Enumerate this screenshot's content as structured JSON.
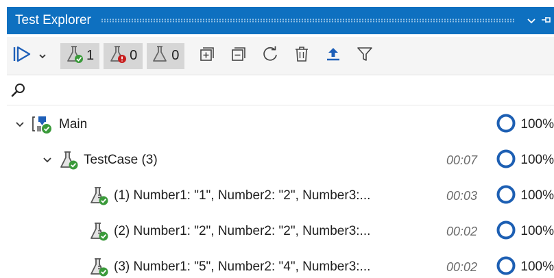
{
  "window": {
    "title": "Test Explorer"
  },
  "toolbar": {
    "passed_count": "1",
    "failed_count": "0",
    "notrun_count": "0"
  },
  "search": {
    "placeholder": ""
  },
  "tree": [
    {
      "label": "Main",
      "duration": "",
      "coverage": "100%"
    },
    {
      "label": "TestCase (3)",
      "duration": "00:07",
      "coverage": "100%"
    },
    {
      "label": "(1) Number1: \"1\", Number2: \"2\", Number3:...",
      "duration": "00:03",
      "coverage": "100%"
    },
    {
      "label": "(2) Number1: \"2\", Number2: \"2\", Number3:...",
      "duration": "00:02",
      "coverage": "100%"
    },
    {
      "label": "(3) Number1: \"5\", Number2: \"4\", Number3:...",
      "duration": "00:02",
      "coverage": "100%"
    }
  ],
  "colors": {
    "accent": "#0e70c0",
    "passed": "#3a9a3a",
    "failed": "#c81e1e",
    "ring": "#1d5fb3"
  },
  "icons": [
    "run-all-icon",
    "chevron-down-icon",
    "flask-passed-icon",
    "flask-failed-icon",
    "flask-icon",
    "expand-all-icon",
    "collapse-all-icon",
    "refresh-icon",
    "delete-icon",
    "upload-icon",
    "filter-icon",
    "search-icon",
    "pin-icon",
    "coverage-ring-icon"
  ]
}
